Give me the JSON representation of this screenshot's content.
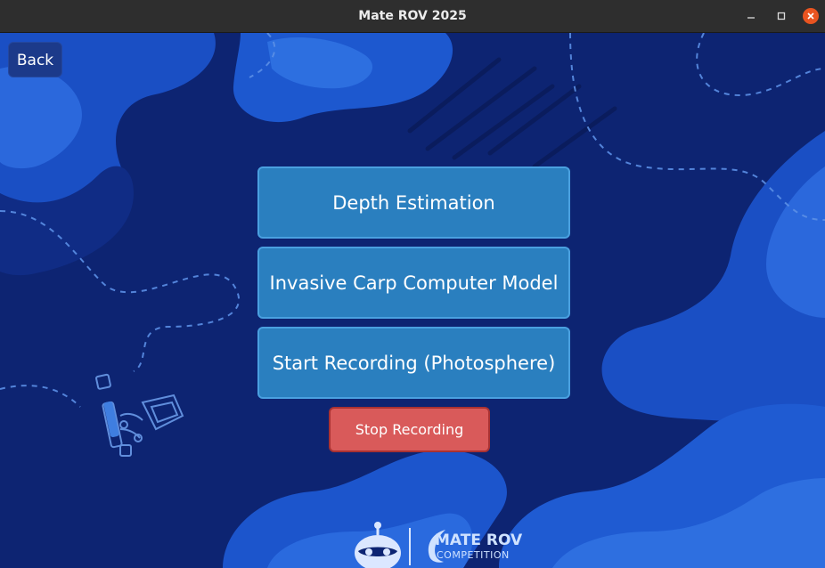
{
  "window": {
    "title": "Mate ROV 2025",
    "controls": [
      "minimize-icon",
      "maximize-icon",
      "close-icon"
    ]
  },
  "nav": {
    "back_label": "Back"
  },
  "menu": {
    "buttons": [
      {
        "label": "Depth Estimation"
      },
      {
        "label": "Invasive Carp Computer Model"
      },
      {
        "label": "Start Recording (Photosphere)"
      }
    ],
    "stop_label": "Stop Recording"
  },
  "footer": {
    "logo_line1": "MATE ROV",
    "logo_line2": "COMPETITION"
  },
  "colors": {
    "background": "#0b1f66",
    "primary_button": "#2a7fbf",
    "stop_button": "#d95a5a",
    "titlebar": "#2e2e2e",
    "close_button": "#e95420"
  }
}
